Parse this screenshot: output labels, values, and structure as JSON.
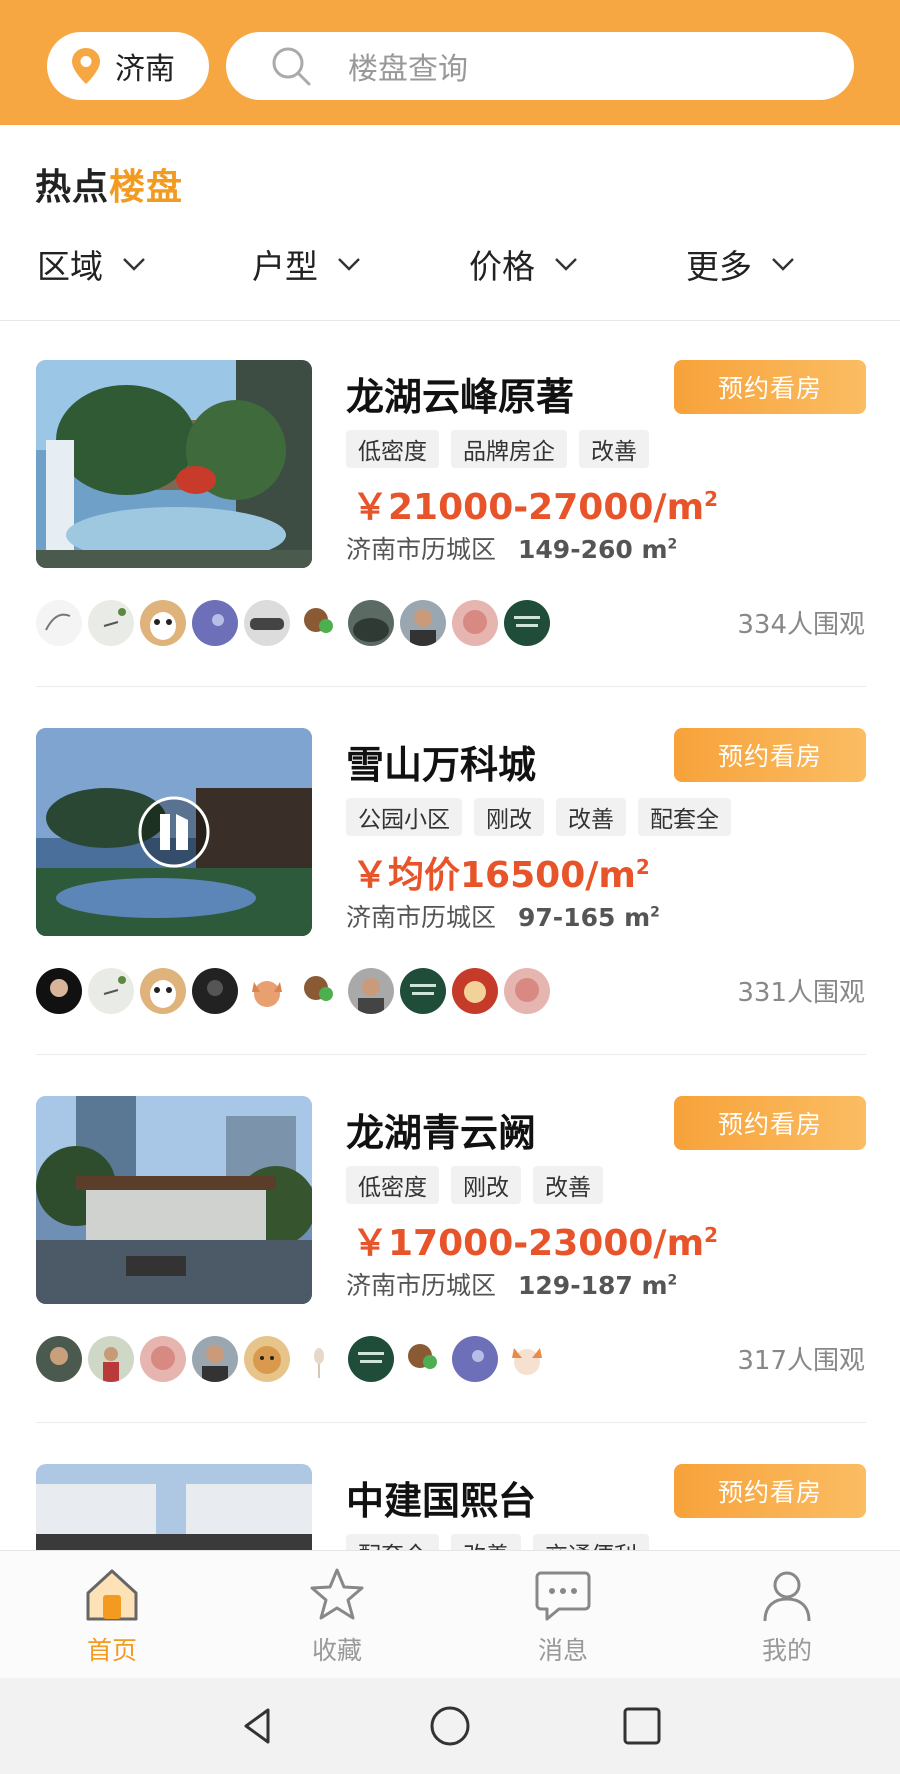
{
  "header": {
    "city": "济南",
    "search_placeholder": "楼盘查询"
  },
  "section": {
    "title_part1": "热点",
    "title_part2": "楼盘"
  },
  "filters": [
    {
      "label": "区域"
    },
    {
      "label": "户型"
    },
    {
      "label": "价格"
    },
    {
      "label": "更多"
    }
  ],
  "listings": [
    {
      "name": "龙湖云峰原著",
      "button": "预约看房",
      "tags": [
        "低密度",
        "品牌房企",
        "改善"
      ],
      "price": "￥21000-27000/m",
      "price_sup": "2",
      "district": "济南市历城区",
      "area": "149-260 m",
      "area_sup": "2",
      "views": "334人围观"
    },
    {
      "name": "雪山万科城",
      "button": "预约看房",
      "tags": [
        "公园小区",
        "刚改",
        "改善",
        "配套全"
      ],
      "price": "￥均价16500/m",
      "price_sup": "2",
      "district": "济南市历城区",
      "area": "97-165 m",
      "area_sup": "2",
      "views": "331人围观"
    },
    {
      "name": "龙湖青云阙",
      "button": "预约看房",
      "tags": [
        "低密度",
        "刚改",
        "改善"
      ],
      "price": "￥17000-23000/m",
      "price_sup": "2",
      "district": "济南市历城区",
      "area": "129-187 m",
      "area_sup": "2",
      "views": "317人围观"
    },
    {
      "name": "中建国熙台",
      "button": "预约看房",
      "tags": [
        "配套全",
        "改善",
        "交通便利"
      ]
    }
  ],
  "tabbar": [
    {
      "label": "首页",
      "icon": "home-icon",
      "active": true
    },
    {
      "label": "收藏",
      "icon": "star-icon",
      "active": false
    },
    {
      "label": "消息",
      "icon": "message-icon",
      "active": false
    },
    {
      "label": "我的",
      "icon": "user-icon",
      "active": false
    }
  ],
  "colors": {
    "accent": "#f6a742",
    "price": "#e8542a"
  }
}
